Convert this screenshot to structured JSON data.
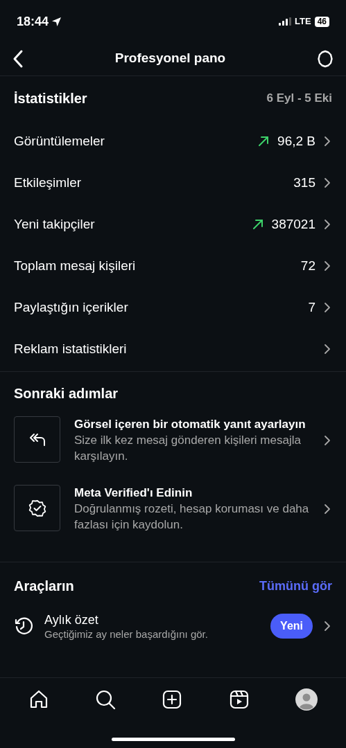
{
  "status_bar": {
    "time": "18:44",
    "network": "LTE",
    "battery": "46"
  },
  "header": {
    "title": "Profesyonel pano"
  },
  "statistics": {
    "title": "İstatistikler",
    "date_range": "6 Eyl - 5 Eki",
    "rows": [
      {
        "label": "Görüntülemeler",
        "value": "96,2 B",
        "trend_up": true
      },
      {
        "label": "Etkileşimler",
        "value": "315",
        "trend_up": false
      },
      {
        "label": "Yeni takipçiler",
        "value": "387021",
        "trend_up": true
      },
      {
        "label": "Toplam mesaj kişileri",
        "value": "72",
        "trend_up": false
      },
      {
        "label": "Paylaştığın içerikler",
        "value": "7",
        "trend_up": false
      },
      {
        "label": "Reklam istatistikleri",
        "trend_up": false
      }
    ]
  },
  "next_steps": {
    "title": "Sonraki adımlar",
    "items": [
      {
        "kind": "reply",
        "title": "Görsel içeren bir otomatik yanıt ayarlayın",
        "description": "Size ilk kez mesaj gönderen kişileri mesajla karşılayın."
      },
      {
        "kind": "verified",
        "title": "Meta Verified'ı Edinin",
        "description": "Doğrulanmış rozeti, hesap koruması ve daha fazlası için kaydolun."
      }
    ]
  },
  "tools": {
    "title": "Araçların",
    "see_all": "Tümünü gör",
    "items": [
      {
        "title": "Aylık özet",
        "description": "Geçtiğimiz ay neler başardığını gör.",
        "badge": "Yeni"
      }
    ]
  },
  "bottom_nav": [
    {
      "kind": "home"
    },
    {
      "kind": "search"
    },
    {
      "kind": "create"
    },
    {
      "kind": "reels"
    },
    {
      "kind": "profile"
    }
  ]
}
